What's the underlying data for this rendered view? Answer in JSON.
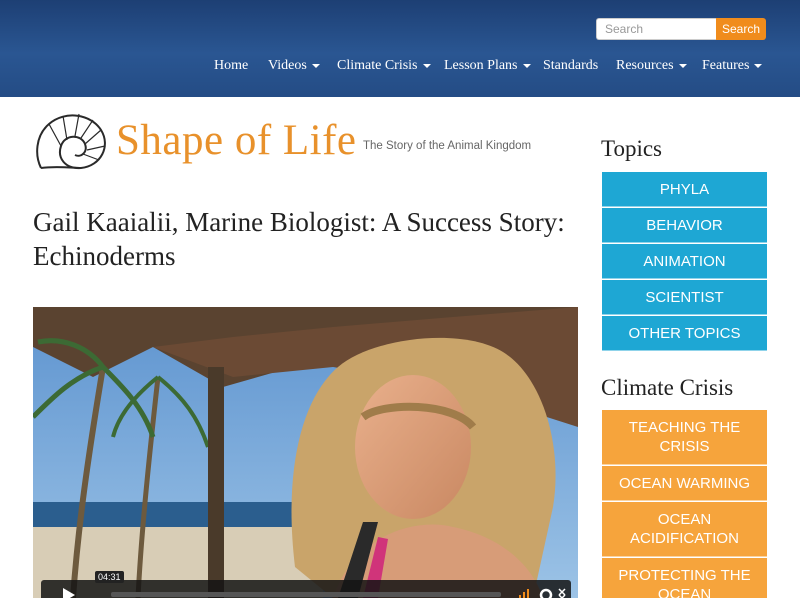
{
  "header": {
    "search": {
      "placeholder": "Search",
      "button_label": "Search"
    },
    "nav": [
      {
        "label": "Home",
        "dropdown": false
      },
      {
        "label": "Videos",
        "dropdown": true
      },
      {
        "label": "Climate Crisis",
        "dropdown": true
      },
      {
        "label": "Lesson Plans",
        "dropdown": true
      },
      {
        "label": "Standards",
        "dropdown": false
      },
      {
        "label": "Resources",
        "dropdown": true
      },
      {
        "label": "Features",
        "dropdown": true
      }
    ]
  },
  "logo": {
    "name": "Shape of Life",
    "tagline": "The Story of the Animal Kingdom"
  },
  "page": {
    "title": "Gail Kaaialii, Marine Biologist: A Success Story: Echinoderms"
  },
  "video": {
    "duration": "04:31"
  },
  "sidebar": {
    "topics_heading": "Topics",
    "topics": [
      "PHYLA",
      "BEHAVIOR",
      "ANIMATION",
      "SCIENTIST",
      "OTHER TOPICS"
    ],
    "climate_heading": "Climate Crisis",
    "climate_items": [
      "TEACHING THE CRISIS",
      "OCEAN WARMING",
      "OCEAN ACIDIFICATION",
      "PROTECTING THE OCEAN"
    ]
  },
  "colors": {
    "header": "#244c85",
    "accent_orange": "#f08c1c",
    "topic_blue": "#1ea7d4",
    "climate_orange": "#f6a43c"
  }
}
